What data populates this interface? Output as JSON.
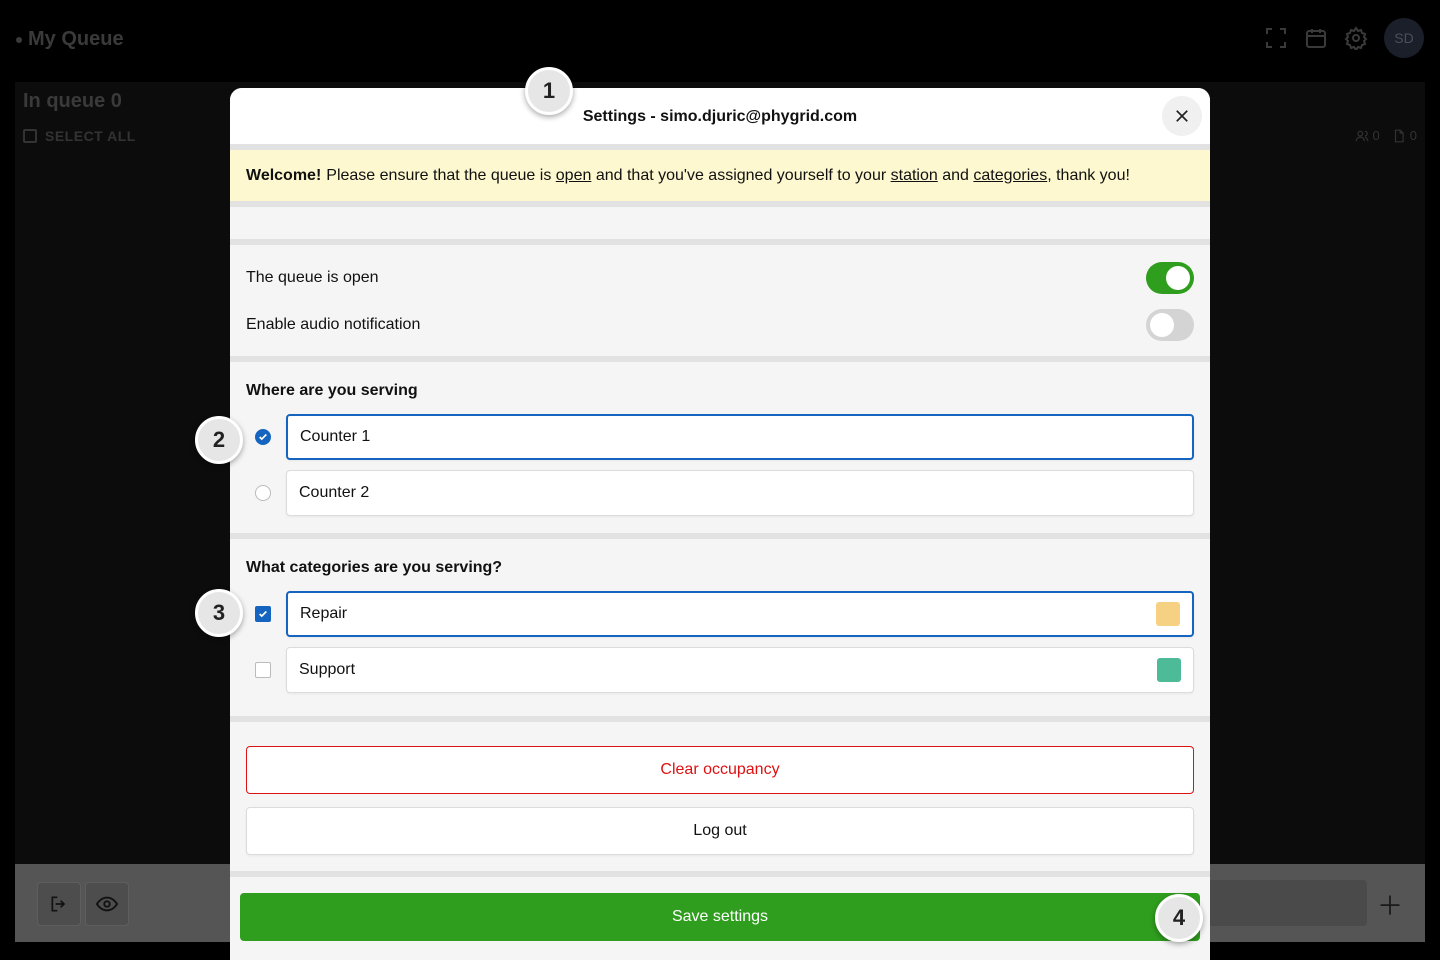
{
  "app": {
    "title": "My Queue",
    "in_queue": "In queue 0",
    "select_all": "SELECT ALL",
    "people_count": "0",
    "docs_count": "0",
    "avatar_initials": "SD"
  },
  "modal": {
    "title": "Settings - simo.djuric@phygrid.com",
    "welcome": {
      "bold": "Welcome!",
      "text1": "Please ensure that the queue is",
      "link_open": "open",
      "text2": "and that you've assigned yourself to your",
      "link_station": "station",
      "text3": "and",
      "link_categories": "categories",
      "text4": ", thank you!"
    },
    "toggles": [
      {
        "label": "The queue is open",
        "on": true
      },
      {
        "label": "Enable audio notification",
        "on": false
      }
    ],
    "serving": {
      "title": "Where are you serving",
      "options": [
        {
          "label": "Counter 1",
          "selected": true
        },
        {
          "label": "Counter 2",
          "selected": false
        }
      ]
    },
    "categories": {
      "title": "What categories are you serving?",
      "options": [
        {
          "label": "Repair",
          "selected": true,
          "color": "#f6d083"
        },
        {
          "label": "Support",
          "selected": false,
          "color": "#4dbb98"
        }
      ]
    },
    "clear_label": "Clear occupancy",
    "logout_label": "Log out",
    "save_label": "Save settings"
  },
  "markers": [
    "1",
    "2",
    "3",
    "4"
  ],
  "colors": {
    "accent_green": "#2f9e1e",
    "accent_blue": "#1565c0",
    "danger": "#dd1111",
    "welcome_bg": "#fdf8cf"
  }
}
